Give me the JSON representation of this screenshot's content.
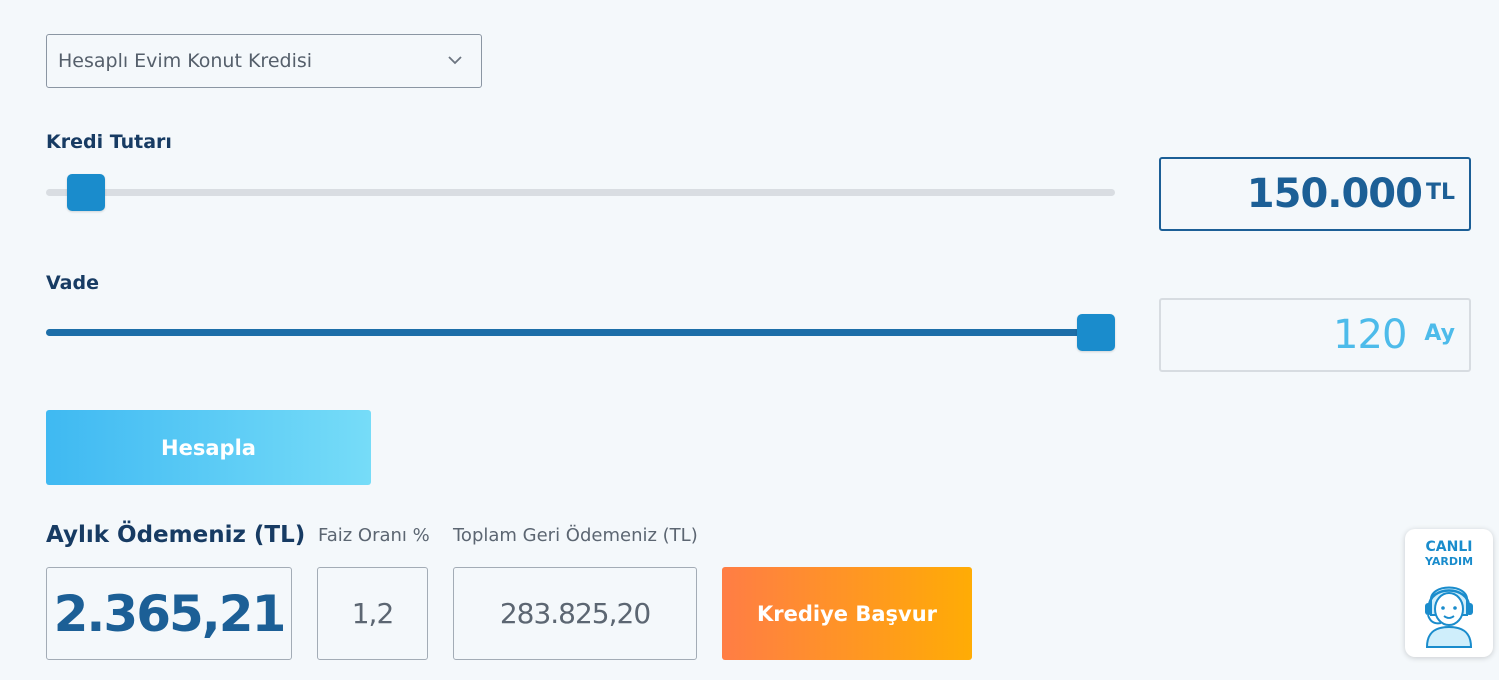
{
  "product_select": {
    "selected": "Hesaplı Evim Konut Kredisi"
  },
  "loan_amount": {
    "label": "Kredi Tutarı",
    "value": "150.000",
    "unit": "TL",
    "slider_fraction": 0.02
  },
  "term": {
    "label": "Vade",
    "value": "120",
    "unit": "Ay",
    "slider_fraction": 1.0
  },
  "calculate_button": {
    "label": "Hesapla"
  },
  "results": {
    "monthly_payment_label": "Aylık Ödemeniz (TL)",
    "monthly_payment_value": "2.365,21",
    "interest_rate_label": "Faiz Oranı %",
    "interest_rate_value": "1,2",
    "total_repayment_label": "Toplam Geri Ödemeniz (TL)",
    "total_repayment_value": "283.825,20"
  },
  "apply_button": {
    "label": "Krediye Başvur"
  },
  "live_help": {
    "line1": "CANLI",
    "line2": "YARDIM",
    "icon": "support-agent-icon"
  },
  "colors": {
    "primary": "#1c5f96",
    "slider_thumb": "#1a8ccc",
    "calculate_gradient_start": "#3fb9f2",
    "calculate_gradient_end": "#76dcf8",
    "apply_gradient_start": "#ff7d45",
    "apply_gradient_end": "#ffac05",
    "term_value": "#4dbbea"
  }
}
